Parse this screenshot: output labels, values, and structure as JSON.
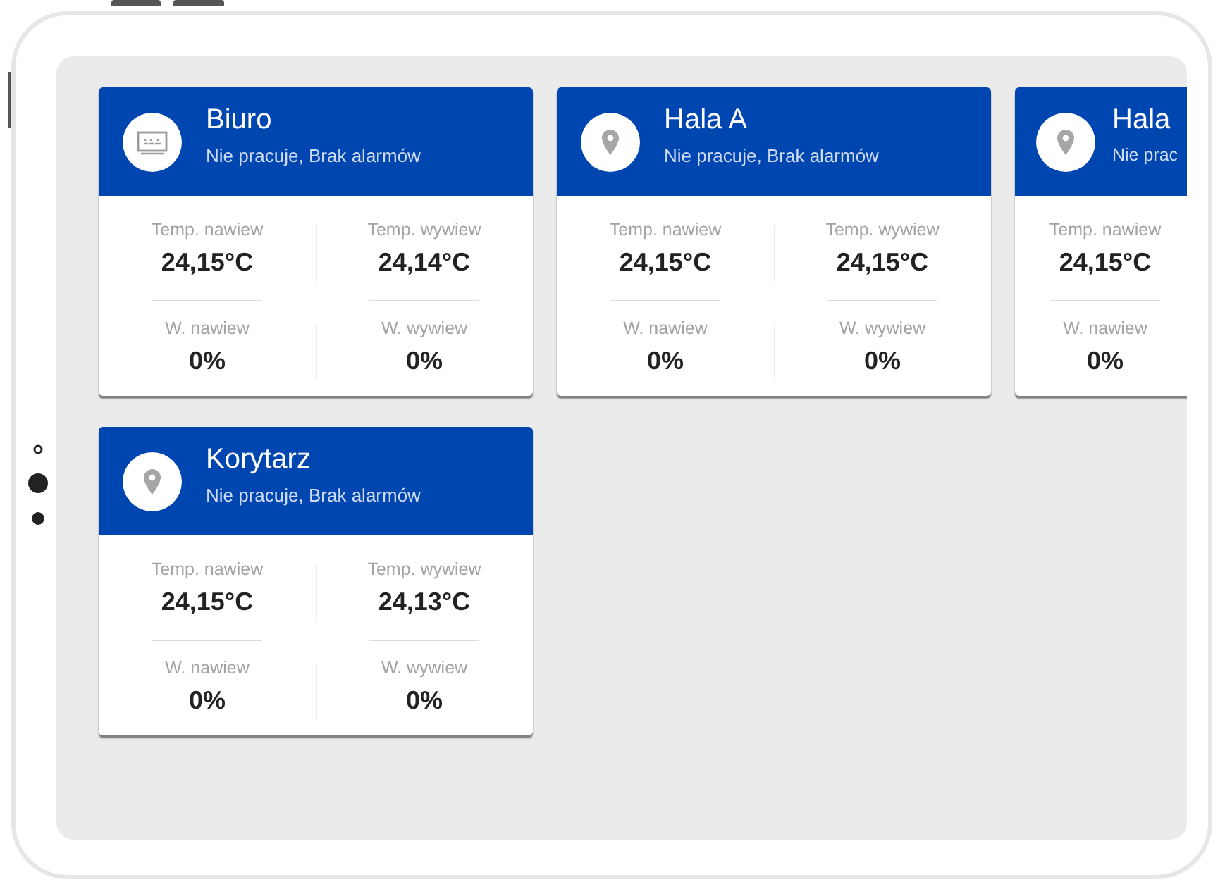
{
  "cards": [
    {
      "title": "Biuro",
      "subtitle": "Nie pracuje, Brak alarmów",
      "kind": "board",
      "rows": [
        [
          {
            "label": "Temp. nawiew",
            "value": "24,15°C"
          },
          {
            "label": "Temp. wywiew",
            "value": "24,14°C"
          }
        ],
        [
          {
            "label": "W. nawiew",
            "value": "0%"
          },
          {
            "label": "W. wywiew",
            "value": "0%"
          }
        ]
      ]
    },
    {
      "title": "Hala A",
      "subtitle": "Nie pracuje, Brak alarmów",
      "kind": "pin",
      "rows": [
        [
          {
            "label": "Temp. nawiew",
            "value": "24,15°C"
          },
          {
            "label": "Temp. wywiew",
            "value": "24,15°C"
          }
        ],
        [
          {
            "label": "W. nawiew",
            "value": "0%"
          },
          {
            "label": "W. wywiew",
            "value": "0%"
          }
        ]
      ]
    },
    {
      "title": "Hala",
      "subtitle": "Nie prac",
      "kind": "pin",
      "rows": [
        [
          {
            "label": "Temp. nawiew",
            "value": "24,15°C"
          }
        ],
        [
          {
            "label": "W. nawiew",
            "value": "0%"
          }
        ]
      ]
    },
    {
      "title": "Korytarz",
      "subtitle": "Nie pracuje, Brak alarmów",
      "kind": "pin",
      "rows": [
        [
          {
            "label": "Temp. nawiew",
            "value": "24,15°C"
          },
          {
            "label": "Temp. wywiew",
            "value": "24,13°C"
          }
        ],
        [
          {
            "label": "W. nawiew",
            "value": "0%"
          },
          {
            "label": "W. wywiew",
            "value": "0%"
          }
        ]
      ]
    }
  ]
}
